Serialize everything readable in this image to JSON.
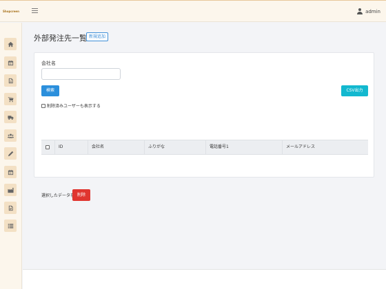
{
  "topbar": {
    "brand": "Shopcreen",
    "user_name": "admin"
  },
  "sidebar": {
    "items": [
      {
        "icon": "home-icon"
      },
      {
        "icon": "calendar-icon"
      },
      {
        "icon": "document-icon"
      },
      {
        "icon": "cart-icon"
      },
      {
        "icon": "truck-icon"
      },
      {
        "icon": "users-icon"
      },
      {
        "icon": "pencil-icon"
      },
      {
        "icon": "calendar-icon"
      },
      {
        "icon": "factory-icon"
      },
      {
        "icon": "file-icon"
      },
      {
        "icon": "list-icon"
      }
    ]
  },
  "page": {
    "title": "外部発注先一覧",
    "new_button": "新規追加"
  },
  "search": {
    "company_label": "会社名",
    "company_value": "",
    "search_button": "検索",
    "csv_button": "CSV出力",
    "show_deleted_label": "削除済みユーザーも表示する"
  },
  "table": {
    "columns": [
      "ID",
      "会社名",
      "ふりがな",
      "電話番号1",
      "メールアドレス"
    ]
  },
  "bulk": {
    "selected_label": "選択したデータを",
    "delete_button": "削除"
  },
  "colors": {
    "primary": "#2b8fdc",
    "info": "#13b8cf",
    "danger": "#e0352f",
    "sidebar_bg": "#fcf6ec",
    "sidebar_btn": "#f3e0c4"
  }
}
